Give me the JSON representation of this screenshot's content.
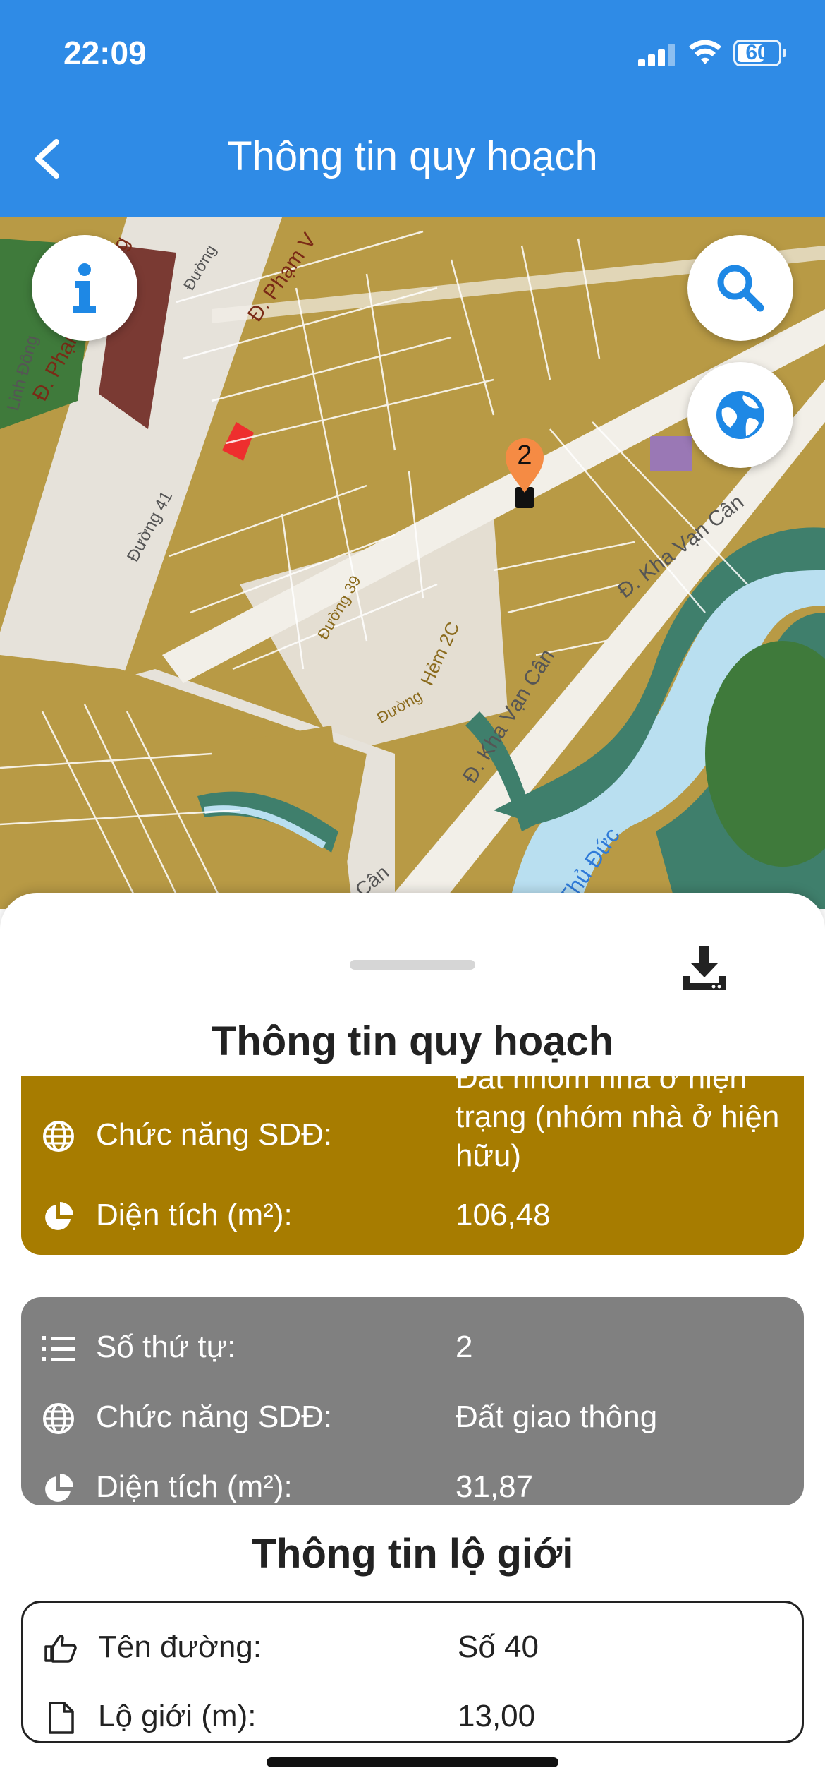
{
  "status_bar": {
    "time": "22:09",
    "battery": "60"
  },
  "header": {
    "title": "Thông tin quy hoạch"
  },
  "map": {
    "streets": [
      "Đ. Phạm Văn Đồng",
      "Đường 41",
      "Đ. Phạm V",
      "Linh Đông",
      "Đường",
      "Đ. Kha Vạn Cân",
      "Đ. Kha Vạn Cân",
      "Hẻm 2C",
      "Đường 39",
      "Đường",
      "Thủ Đức",
      "n Cân"
    ],
    "marker_number": "2"
  },
  "sheet": {
    "title": "Thông tin quy hoạch",
    "gold_card": {
      "function_label": "Chức năng SDĐ:",
      "function_value": "Đất nhóm nhà ở hiện trạng (nhóm nhà ở hiện hữu)",
      "area_label": "Diện tích (m²):",
      "area_value": "106,48"
    },
    "gray_card": {
      "order_label": "Số thứ tự:",
      "order_value": "2",
      "function_label": "Chức năng SDĐ:",
      "function_value": "Đất giao thông",
      "area_label": "Diện tích (m²):",
      "area_value": "31,87"
    },
    "road_title": "Thông tin lộ giới",
    "road_card": {
      "name_label": "Tên đường:",
      "name_value": "Số 40",
      "width_label": "Lộ giới (m):",
      "width_value": "13,00"
    }
  },
  "colors": {
    "header": "#2f8be6",
    "gold": "#a77c00",
    "gray": "#808080"
  }
}
